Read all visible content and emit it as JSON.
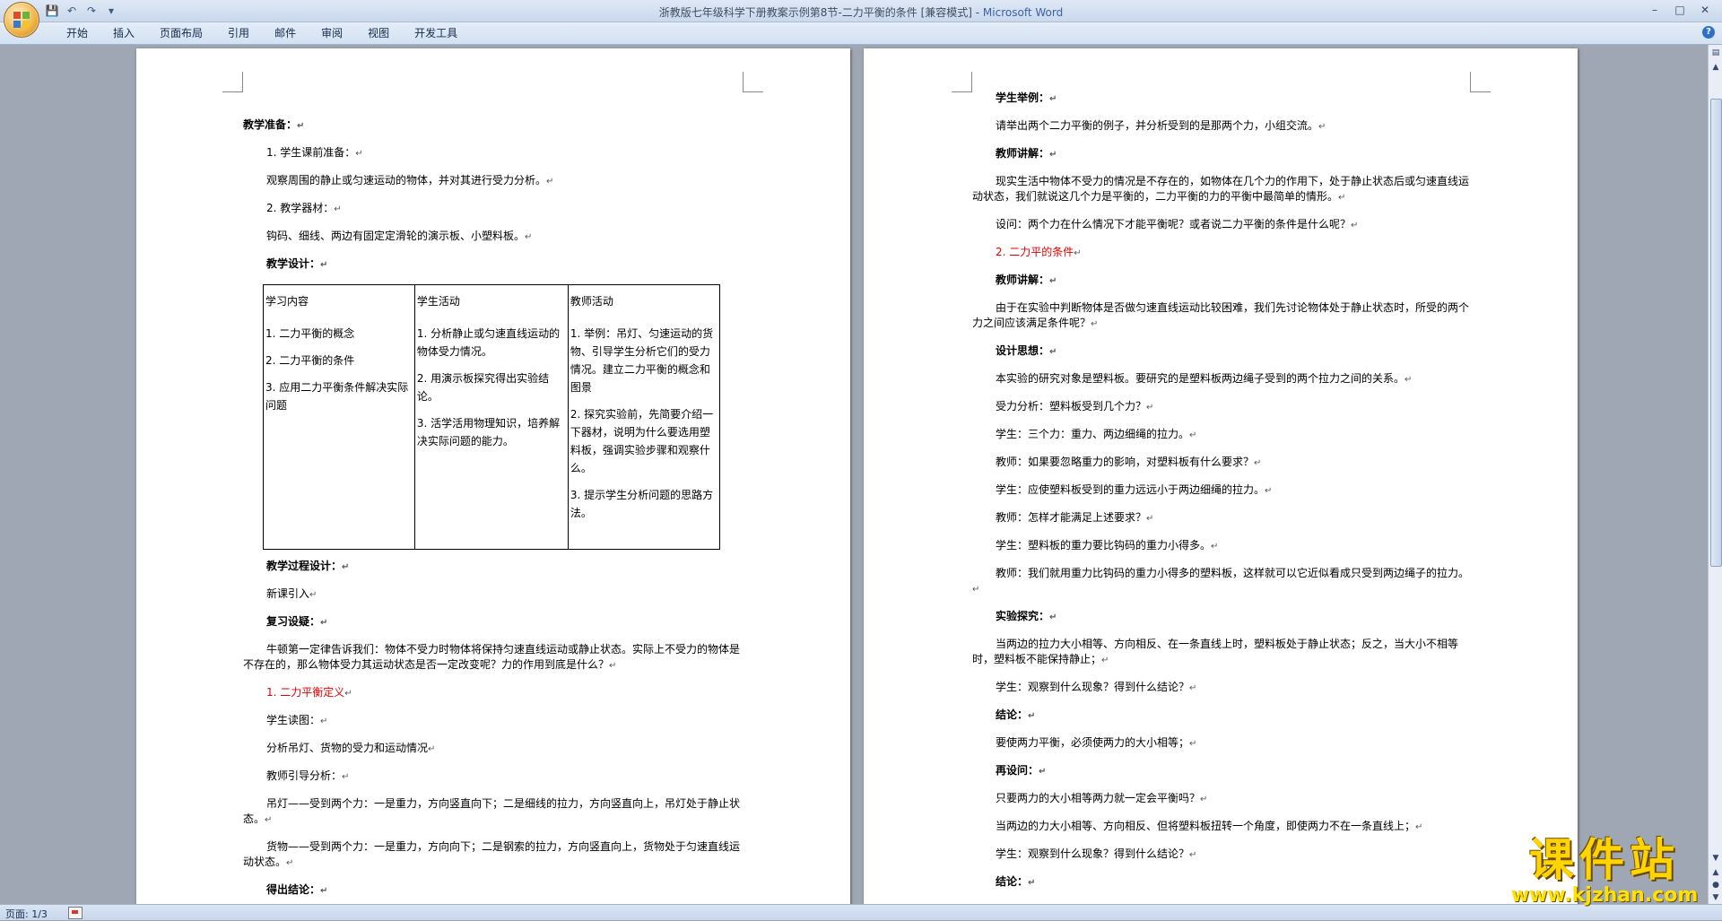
{
  "window": {
    "title": "浙教版七年级科学下册教案示例第8节-二力平衡的条件 [兼容模式]",
    "app_name": "Microsoft Word"
  },
  "qat": {
    "save": "💾",
    "undo": "↶",
    "redo": "↷",
    "customize": "▾"
  },
  "ribbon_tabs": [
    "开始",
    "插入",
    "页面布局",
    "引用",
    "邮件",
    "审阅",
    "视图",
    "开发工具"
  ],
  "page_left": {
    "p1": "教学准备：",
    "p2": "1. 学生课前准备：",
    "p3": "观察周围的静止或匀速运动的物体，并对其进行受力分析。",
    "p4": "2. 教学器材：",
    "p5": "钩码、细线、两边有固定定滑轮的演示板、小塑料板。",
    "p6": "教学设计：",
    "table": {
      "h1": "学习内容",
      "h2": "学生活动",
      "h3": "教师活动",
      "c1": [
        "1. 二力平衡的概念",
        "2. 二力平衡的条件",
        "3. 应用二力平衡条件解决实际问题"
      ],
      "c2": [
        "1. 分析静止或匀速直线运动的物体受力情况。",
        "2. 用演示板探究得出实验结论。",
        "3. 活学活用物理知识，培养解决实际问题的能力。"
      ],
      "c3": [
        "1. 举例：吊灯、匀速运动的货物、引导学生分析它们的受力情况。建立二力平衡的概念和图景",
        "2. 探究实验前，先简要介绍一下器材，说明为什么要选用塑料板，强调实验步骤和观察什么。",
        "3. 提示学生分析问题的思路方法。"
      ]
    },
    "p7": "教学过程设计：",
    "p8": "新课引入",
    "p9": "复习设疑：",
    "p10": "牛顿第一定律告诉我们：物体不受力时物体将保持匀速直线运动或静止状态。实际上不受力的物体是不存在的，那么物体受力其运动状态是否一定改变呢？力的作用到底是什么？",
    "p11": "1. 二力平衡定义",
    "p12": "学生读图：",
    "p13": "分析吊灯、货物的受力和运动情况",
    "p14": "教师引导分析：",
    "p15": "吊灯——受到两个力：一是重力，方向竖直向下；二是细线的拉力，方向竖直向上，吊灯处于静止状态。",
    "p16": "货物——受到两个力：一是重力，方向向下；二是钢索的拉力，方向竖直向上，货物处于匀速直线运动状态。",
    "p17": "得出结论："
  },
  "page_right": {
    "p1": "学生举例：",
    "p2": "请举出两个二力平衡的例子，并分析受到的是那两个力，小组交流。",
    "p3": "教师讲解：",
    "p4": "现实生活中物体不受力的情况是不存在的，如物体在几个力的作用下，处于静止状态后或匀速直线运动状态，我们就说这几个力是平衡的，二力平衡的力的平衡中最简单的情形。",
    "p5": "设问：两个力在什么情况下才能平衡呢？或者说二力平衡的条件是什么呢？",
    "p6": "2. 二力平的条件",
    "p7": "教师讲解：",
    "p8": "由于在实验中判断物体是否做匀速直线运动比较困难，我们先讨论物体处于静止状态时，所受的两个力之间应该满足条件呢？",
    "p9": "设计思想：",
    "p10": "本实验的研究对象是塑料板。要研究的是塑料板两边绳子受到的两个拉力之间的关系。",
    "p11": "受力分析：塑料板受到几个力？",
    "p12": "学生：三个力：重力、两边细绳的拉力。",
    "p13": "教师：如果要忽略重力的影响，对塑料板有什么要求？",
    "p14": "学生：应使塑料板受到的重力远远小于两边细绳的拉力。",
    "p15": "教师：怎样才能满足上述要求？",
    "p16": "学生：塑料板的重力要比钩码的重力小得多。",
    "p17": "教师：我们就用重力比钩码的重力小得多的塑料板，这样就可以它近似看成只受到两边绳子的拉力。",
    "p18": "实验探究：",
    "p19": "当两边的拉力大小相等、方向相反、在一条直线上时，塑料板处于静止状态；反之，当大小不相等时，塑料板不能保持静止；",
    "p20": "学生：观察到什么现象？得到什么结论？",
    "p21": "结论：",
    "p22": "要使两力平衡，必须使两力的大小相等；",
    "p23": "再设问：",
    "p24": "只要两力的大小相等两力就一定会平衡吗？",
    "p25": "当两边的力大小相等、方向相反、但将塑料板扭转一个角度，即使两力不在一条直线上；",
    "p26": "学生：观察到什么现象？得到什么结论？",
    "p27": "结论："
  },
  "status_bar": {
    "page": "页面: 1/3"
  },
  "watermark": {
    "big": "课件站",
    "url": "www.kjzhan.com"
  },
  "colors": {
    "ribbon": "#d3e1f2",
    "heading_red": "#e10000",
    "workspace": "#9ea7b3"
  }
}
